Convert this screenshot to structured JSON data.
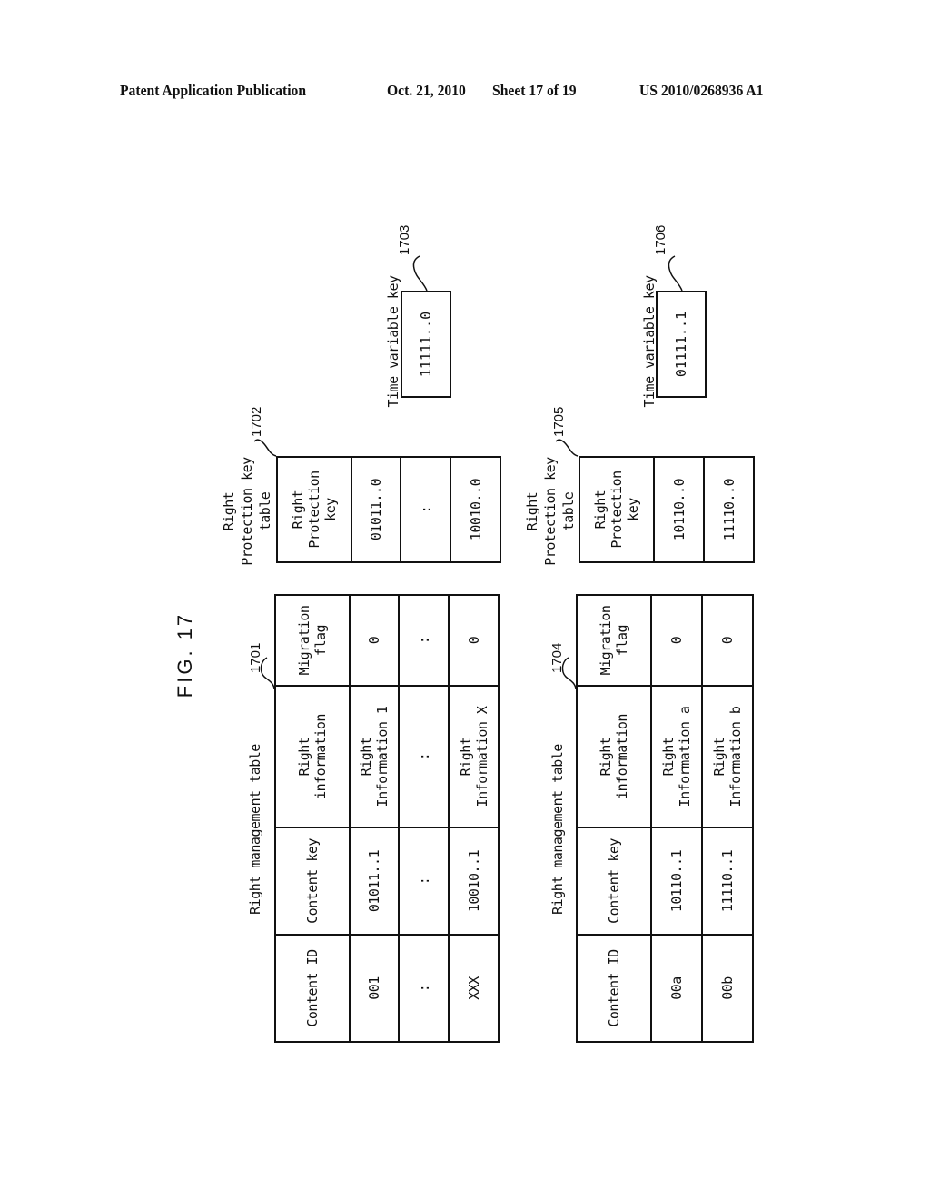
{
  "header": {
    "left": "Patent Application Publication",
    "date": "Oct. 21, 2010",
    "sheet": "Sheet 17 of 19",
    "number": "US 2010/0268936 A1"
  },
  "figure_label": "FIG. 17",
  "group1": {
    "rm_table": {
      "title": "Right management table",
      "ref": "1701",
      "headers": [
        "Content ID",
        "Content key",
        "Right information",
        "Migration flag"
      ],
      "rows": [
        [
          "001",
          "01011..1",
          "Right Information 1",
          "0"
        ],
        [
          ":",
          ":",
          ":",
          ":"
        ],
        [
          "XXX",
          "10010..1",
          "Right Information X",
          "0"
        ]
      ]
    },
    "rp_table": {
      "title": "Right Protection key table",
      "ref": "1702",
      "header": "Right Protection key",
      "rows": [
        "01011..0",
        ":",
        "10010..0"
      ]
    },
    "tv_key": {
      "title": "Time variable key",
      "ref": "1703",
      "value": "11111..0"
    }
  },
  "group2": {
    "rm_table": {
      "title": "Right management table",
      "ref": "1704",
      "headers": [
        "Content ID",
        "Content key",
        "Right information",
        "Migration flag"
      ],
      "rows": [
        [
          "00a",
          "10110..1",
          "Right Information a",
          "0"
        ],
        [
          "00b",
          "11110..1",
          "Right Information b",
          "0"
        ]
      ]
    },
    "rp_table": {
      "title": "Right Protection key table",
      "ref": "1705",
      "header": "Right Protection key",
      "rows": [
        "10110..0",
        "11110..0"
      ]
    },
    "tv_key": {
      "title": "Time variable key",
      "ref": "1706",
      "value": "01111..1"
    }
  }
}
